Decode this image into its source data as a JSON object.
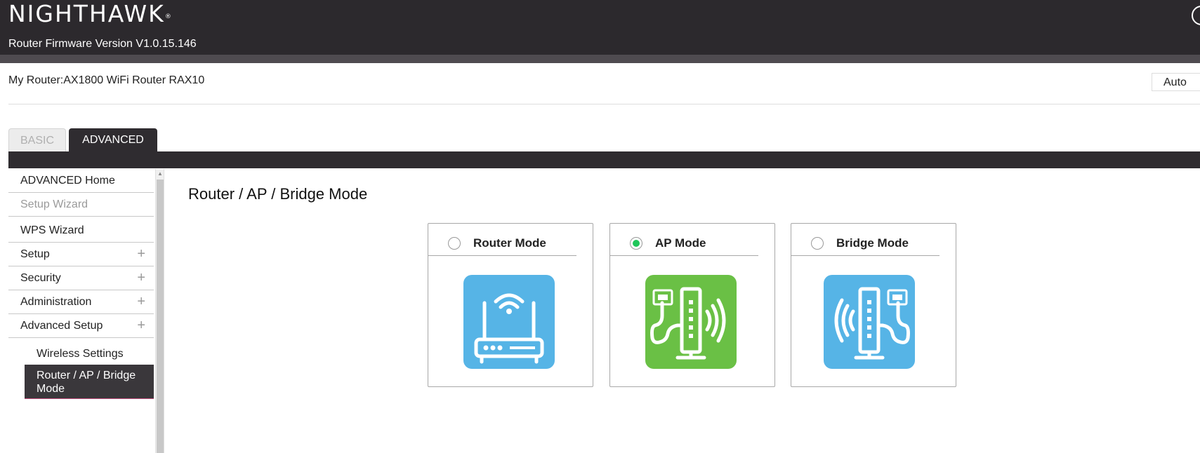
{
  "header": {
    "logo": "NIGHTHAWK",
    "logo_mark": "®",
    "firmware": "Router Firmware Version V1.0.15.146"
  },
  "router": {
    "label": "My Router:",
    "model": "AX1800 WiFi Router RAX10",
    "auto_label": "Auto"
  },
  "tabs": [
    {
      "label": "BASIC"
    },
    {
      "label": "ADVANCED"
    }
  ],
  "sidebar": {
    "items": [
      {
        "label": "ADVANCED Home"
      },
      {
        "label": "Setup Wizard"
      },
      {
        "label": "WPS Wizard"
      },
      {
        "label": "Setup"
      },
      {
        "label": "Security"
      },
      {
        "label": "Administration"
      },
      {
        "label": "Advanced Setup"
      }
    ],
    "sub_items": [
      {
        "label": "Wireless Settings"
      },
      {
        "label": "Router / AP / Bridge Mode"
      }
    ],
    "plus": "+"
  },
  "main": {
    "title": "Router / AP / Bridge Mode",
    "modes": [
      {
        "label": "Router Mode",
        "selected": false,
        "icon": "router-icon",
        "color": "#56b4e6"
      },
      {
        "label": "AP Mode",
        "selected": true,
        "icon": "access-point-icon",
        "color": "#6ac045"
      },
      {
        "label": "Bridge Mode",
        "selected": false,
        "icon": "bridge-icon",
        "color": "#56b4e6"
      }
    ]
  },
  "colors": {
    "topbar": "#2c292d",
    "radio_selected": "#1fc65a",
    "blue_icon": "#56b4e6",
    "green_icon": "#6ac045"
  }
}
